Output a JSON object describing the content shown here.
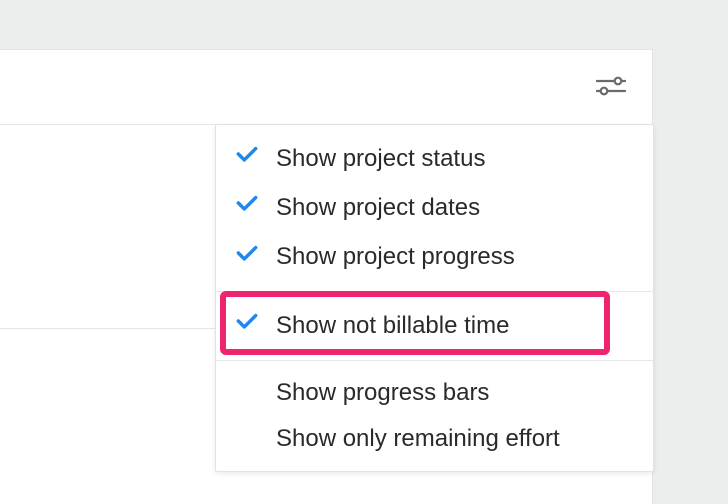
{
  "menu": {
    "groups": [
      {
        "items": [
          {
            "label": "Show project status",
            "checked": true
          },
          {
            "label": "Show project dates",
            "checked": true
          },
          {
            "label": "Show project progress",
            "checked": true
          }
        ]
      },
      {
        "items": [
          {
            "label": "Show not billable time",
            "checked": true,
            "highlighted": true
          }
        ]
      },
      {
        "items": [
          {
            "label": "Show progress bars",
            "checked": false
          },
          {
            "label": "Show only remaining effort",
            "checked": false
          }
        ]
      }
    ]
  },
  "colors": {
    "accent": "#1e87f0",
    "highlight": "#ef246f"
  }
}
